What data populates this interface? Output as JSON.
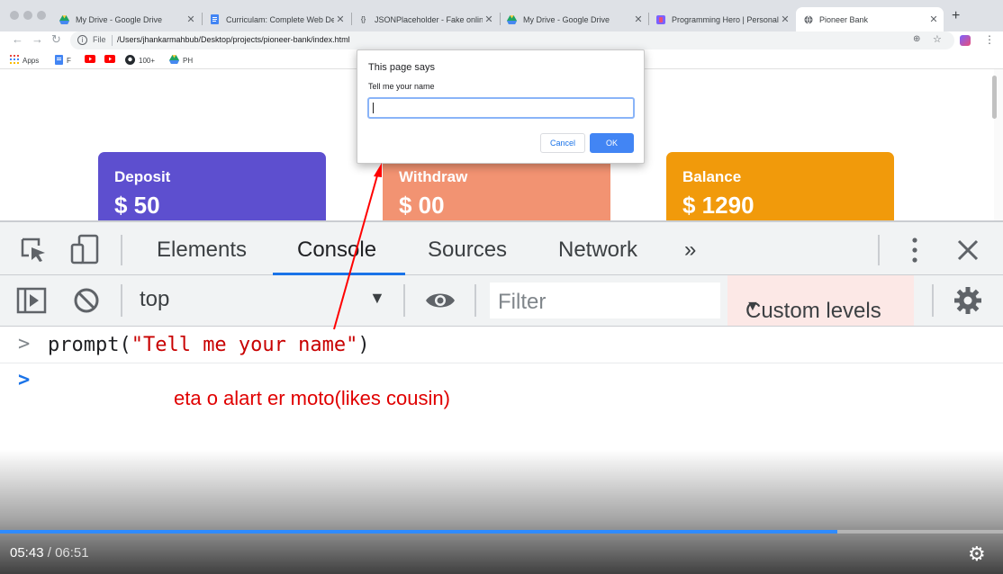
{
  "browser": {
    "tabs": [
      {
        "title": "My Drive - Google Drive",
        "favicon": "google-drive-icon"
      },
      {
        "title": "Curriculam: Complete Web Dev",
        "favicon": "google-docs-icon"
      },
      {
        "title": "JSONPlaceholder - Fake online",
        "favicon": "code-brackets-icon"
      },
      {
        "title": "My Drive - Google Drive",
        "favicon": "google-drive-icon"
      },
      {
        "title": "Programming Hero | Personal",
        "favicon": "programming-hero-icon"
      },
      {
        "title": "Pioneer Bank",
        "favicon": "globe-icon"
      }
    ],
    "new_tab": "+",
    "address": {
      "scheme_label": "File",
      "url": "/Users/jhankarmahbub/Desktop/projects/pioneer-bank/index.html"
    },
    "bookmarks": [
      {
        "label": "Apps",
        "icon": "apps-grid-icon"
      },
      {
        "label": "F",
        "icon": "google-docs-icon"
      },
      {
        "label": "",
        "icon": "youtube-icon"
      },
      {
        "label": "",
        "icon": "youtube-icon"
      },
      {
        "label": "100+",
        "icon": "github-icon"
      },
      {
        "label": "PH",
        "icon": "google-drive-icon"
      }
    ]
  },
  "page": {
    "cards": [
      {
        "label": "Deposit",
        "amount": "$ 50",
        "color": "#5d4fcf"
      },
      {
        "label": "Withdraw",
        "amount": "$ 00",
        "color": "#f29372"
      },
      {
        "label": "Balance",
        "amount": "$ 1290",
        "color": "#f19a0b"
      }
    ]
  },
  "dialog": {
    "title": "This page says",
    "message": "Tell me your name",
    "input_value": "",
    "cancel_label": "Cancel",
    "ok_label": "OK"
  },
  "devtools": {
    "tabs": [
      "Elements",
      "Console",
      "Sources",
      "Network"
    ],
    "active_tab": "Console",
    "more_label": "»",
    "context": "top",
    "filter_placeholder": "Filter",
    "levels_label": "Custom levels",
    "console": {
      "fn": "prompt(",
      "arg": "\"Tell me your name\"",
      "close": ")"
    }
  },
  "annotation": "eta o alart er moto(likes cousin)",
  "video": {
    "current_time": "05:43",
    "separator": "/",
    "total_time": "06:51",
    "progress": 0.835,
    "progress_color": "#2f8bff"
  }
}
